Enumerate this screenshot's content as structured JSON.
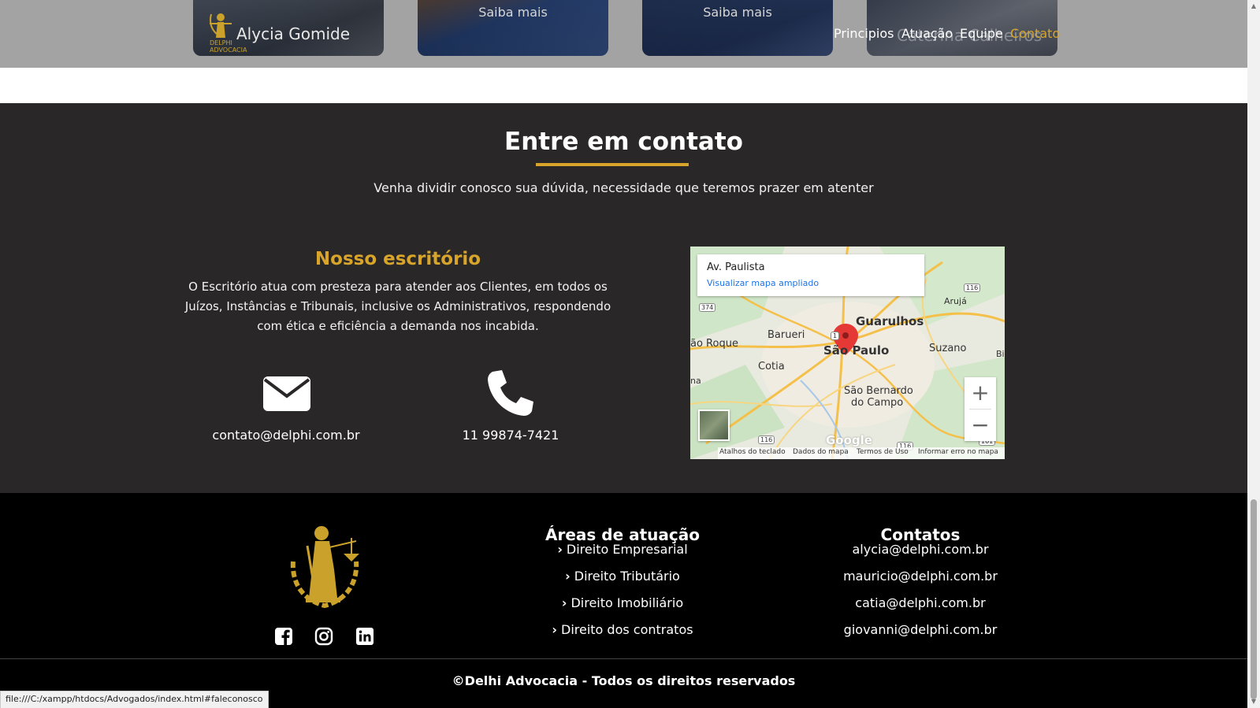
{
  "team": {
    "cards": [
      {
        "label": ""
      },
      {
        "label": "Saiba mais"
      },
      {
        "label": "Saiba mais"
      },
      {
        "label": ""
      }
    ],
    "first_member_name": "Alycia Gomide",
    "mini_logo_line1": "DELPHI",
    "mini_logo_line2": "ADVOCACIA",
    "ghost_name": "Caterina Calheiros"
  },
  "nav": {
    "items": [
      "Principios",
      "Atuação",
      "Equipe",
      "Contato"
    ],
    "active_color": "#d8a52a"
  },
  "contact": {
    "title": "Entre em contato",
    "subtitle": "Venha dividir conosco sua dúvida, necessidade que teremos prazer em atenter",
    "office_title": "Nosso escritório",
    "office_text": "O Escritório atua com presteza para atender aos Clientes, em todos os Juízos, Instâncias e Tribunais, inclusive os Administrativos, respondendo com ética e eficiência a demanda nos incabida.",
    "email": "contato@delphi.com.br",
    "email_icon": "envelope-icon",
    "phone": "11 99874-7421",
    "phone_icon": "phone-icon"
  },
  "map": {
    "place_title": "Av. Paulista",
    "place_link": "Visualizar mapa ampliado",
    "cities": [
      "Guarulhos",
      "Arujá",
      "Barueri",
      "ão Roque",
      "São Paulo",
      "Suzano",
      "Cotia",
      "São Bernardo",
      "do Campo",
      "na",
      "Bi"
    ],
    "roads": [
      "116",
      "374",
      "116",
      "116",
      "101",
      "1"
    ],
    "zoom_in": "+",
    "zoom_out": "−",
    "brand": "Google",
    "footer_links": [
      "Atalhos do teclado",
      "Dados do mapa",
      "Termos de Uso",
      "Informar erro no mapa"
    ]
  },
  "footer": {
    "logo_icon": "lady-justice-logo-icon",
    "social": [
      "facebook-icon",
      "instagram-icon",
      "linkedin-icon"
    ],
    "areas_title": "Áreas de atuação",
    "areas": [
      "Direito Empresarial",
      "Direito Tributário",
      "Direito Imobiliário",
      "Direito dos contratos"
    ],
    "contacts_title": "Contatos",
    "contacts": [
      "alycia@delphi.com.br",
      "mauricio@delphi.com.br",
      "catia@delphi.com.br",
      "giovanni@delphi.com.br"
    ],
    "copyright": "©Delhi Advocacia - Todos os direitos reservados"
  },
  "status_url": "file:///C:/xampp/htdocs/Advogados/index.html#faleconosco",
  "colors": {
    "accent": "#d8a52a",
    "dark_section": "#2a2729",
    "footer": "#000000"
  }
}
